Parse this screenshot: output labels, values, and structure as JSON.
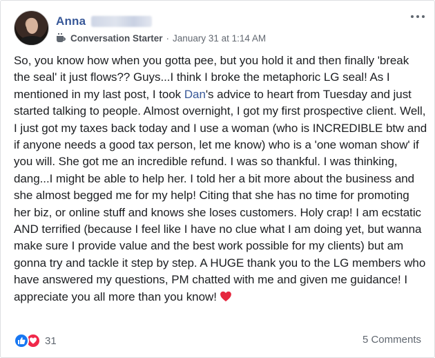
{
  "post": {
    "author": "Anna",
    "badge": "Conversation Starter",
    "separator": "·",
    "timestamp": "January 31 at 1:14 AM",
    "body_before_link": "So, you know how when you gotta pee, but you hold it and then finally 'break the seal' it just flows?? Guys...I think I broke the metaphoric LG seal! As I mentioned in my last post, I took ",
    "mention": "Dan",
    "body_after_link": "'s advice to heart from Tuesday and just started talking to people. Almost overnight, I got my first prospective client. Well, I just got my taxes back today and I use a woman (who is INCREDIBLE btw and if anyone needs a good tax person, let me know) who is a 'one woman show' if you will. She got me an incredible refund. I was so thankful. I was thinking, dang...I might be able to help her. I told her a bit more about the business and she almost begged me for my help! Citing that she has no time for promoting her biz, or online stuff and knows she loses customers. Holy crap! I am ecstatic AND terrified (because I feel like I have no clue what I am doing yet, but wanna make sure I provide value and the best work possible for my clients) but am gonna try and tackle it step by step. A HUGE thank you to the LG members who have answered my questions, PM chatted with me and given me guidance! I appreciate you all more than you know!",
    "emoji": "heart-emoji"
  },
  "footer": {
    "reaction_count": "31",
    "reaction_icons": [
      "like-icon",
      "love-icon"
    ],
    "comments_label": "5 Comments"
  },
  "colors": {
    "link": "#385898",
    "like": "#1877f2",
    "love": "#f0284a",
    "meta": "#616770"
  }
}
